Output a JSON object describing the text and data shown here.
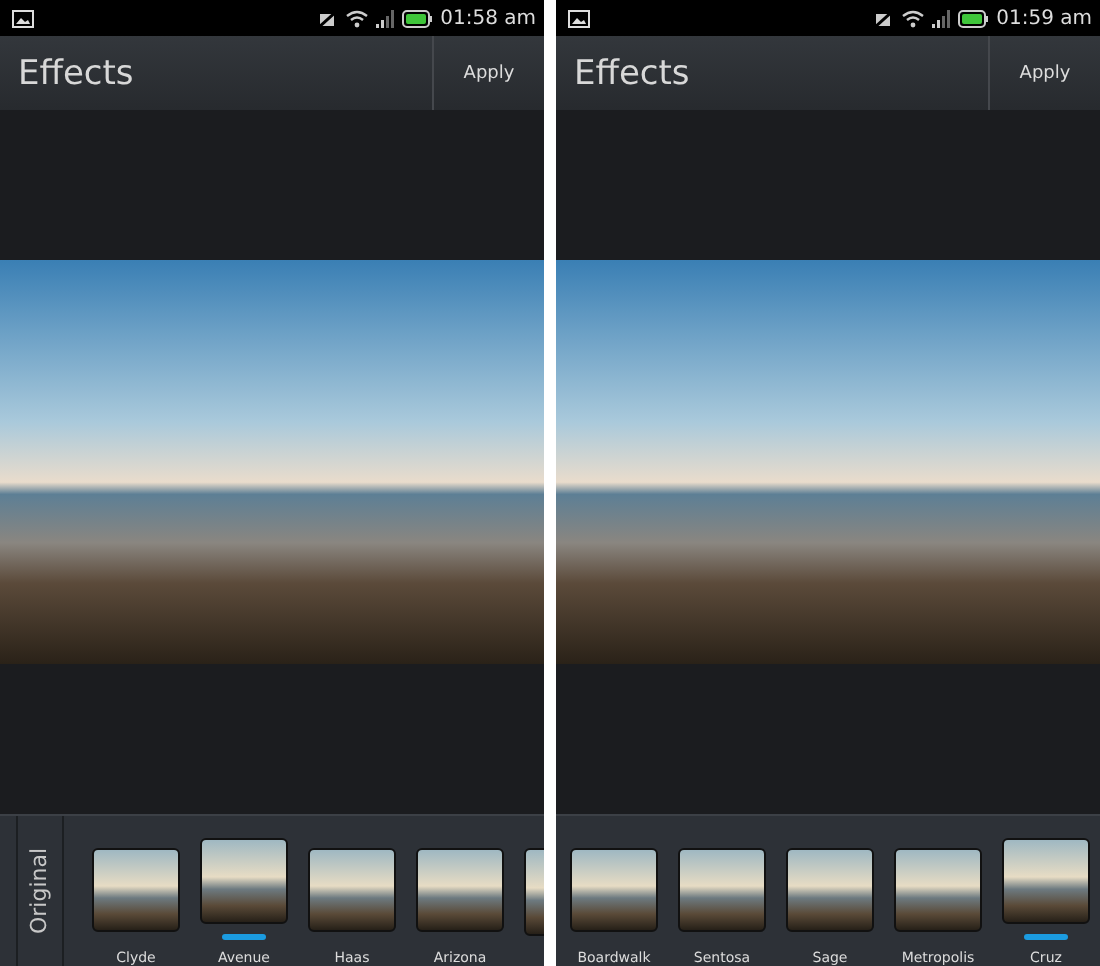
{
  "screens": [
    {
      "status_bar": {
        "time": "01:58 am"
      },
      "title": "Effects",
      "action": "Apply",
      "original_label": "Original",
      "filters": [
        {
          "label": "Clyde",
          "selected": false
        },
        {
          "label": "Avenue",
          "selected": true
        },
        {
          "label": "Haas",
          "selected": false
        },
        {
          "label": "Arizona",
          "selected": false
        },
        {
          "selected": false
        }
      ]
    },
    {
      "status_bar": {
        "time": "01:59 am"
      },
      "title": "Effects",
      "action": "Apply",
      "filters": [
        {
          "label": "Boardwalk",
          "selected": false
        },
        {
          "label": "Sentosa",
          "selected": false
        },
        {
          "label": "Sage",
          "selected": false
        },
        {
          "label": "Metropolis",
          "selected": false
        },
        {
          "label": "Cruz",
          "selected": true
        }
      ]
    }
  ]
}
